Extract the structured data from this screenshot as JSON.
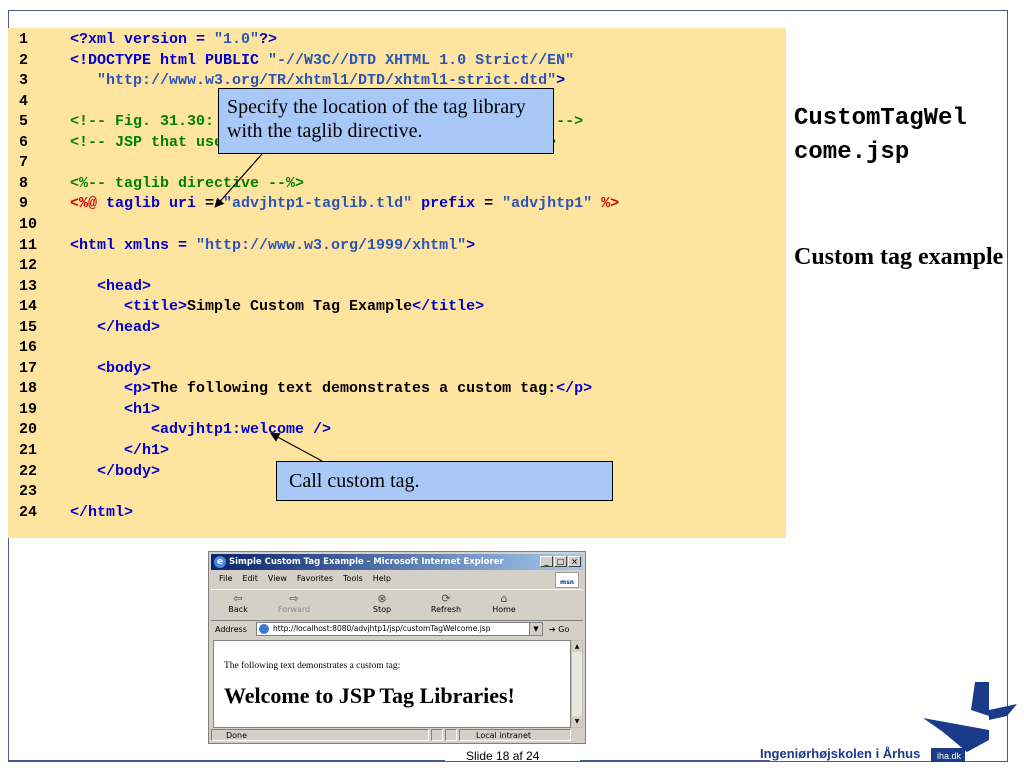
{
  "code_lines": [
    {
      "num": "1",
      "parts": [
        {
          "t": "<?xml version = ",
          "c": "tag"
        },
        {
          "t": "\"1.0\"",
          "c": "str"
        },
        {
          "t": "?>",
          "c": "tag"
        }
      ]
    },
    {
      "num": "2",
      "parts": [
        {
          "t": "<!DOCTYPE html PUBLIC ",
          "c": "tag"
        },
        {
          "t": "\"-//W3C//DTD XHTML 1.0 Strict//EN\"",
          "c": "str"
        }
      ]
    },
    {
      "num": "3",
      "parts": [
        {
          "t": "   \"http://www.w3.org/TR/xhtml1/DTD/xhtml1-strict.dtd\"",
          "c": "str"
        },
        {
          "t": ">",
          "c": "tag"
        }
      ]
    },
    {
      "num": "4",
      "parts": []
    },
    {
      "num": "5",
      "parts": [
        {
          "t": "<!-- Fig. 31.30: CustomTagWelcome.jsp                 -->",
          "c": "com"
        }
      ]
    },
    {
      "num": "6",
      "parts": [
        {
          "t": "<!-- JSP that uses a custom tag to output content. -->",
          "c": "com"
        }
      ]
    },
    {
      "num": "7",
      "parts": []
    },
    {
      "num": "8",
      "parts": [
        {
          "t": "<%-- taglib directive --%>",
          "c": "com"
        }
      ]
    },
    {
      "num": "9",
      "parts": [
        {
          "t": "<%@ ",
          "c": "dir"
        },
        {
          "t": "taglib uri",
          "c": "tag"
        },
        {
          "t": " = ",
          "c": "txt"
        },
        {
          "t": "\"advjhtp1-taglib.tld\"",
          "c": "str"
        },
        {
          "t": " prefix",
          "c": "tag"
        },
        {
          "t": " = ",
          "c": "txt"
        },
        {
          "t": "\"advjhtp1\"",
          "c": "str"
        },
        {
          "t": " %>",
          "c": "dir"
        }
      ]
    },
    {
      "num": "10",
      "parts": []
    },
    {
      "num": "11",
      "parts": [
        {
          "t": "<html xmlns = ",
          "c": "tag"
        },
        {
          "t": "\"http://www.w3.org/1999/xhtml\"",
          "c": "str"
        },
        {
          "t": ">",
          "c": "tag"
        }
      ]
    },
    {
      "num": "12",
      "parts": []
    },
    {
      "num": "13",
      "parts": [
        {
          "t": "   <head>",
          "c": "tag"
        }
      ]
    },
    {
      "num": "14",
      "parts": [
        {
          "t": "      <title>",
          "c": "tag"
        },
        {
          "t": "Simple Custom Tag Example",
          "c": "txt"
        },
        {
          "t": "</title>",
          "c": "tag"
        }
      ]
    },
    {
      "num": "15",
      "parts": [
        {
          "t": "   </head>",
          "c": "tag"
        }
      ]
    },
    {
      "num": "16",
      "parts": []
    },
    {
      "num": "17",
      "parts": [
        {
          "t": "   <body>",
          "c": "tag"
        }
      ]
    },
    {
      "num": "18",
      "parts": [
        {
          "t": "      <p>",
          "c": "tag"
        },
        {
          "t": "The following text demonstrates a custom tag:",
          "c": "txt"
        },
        {
          "t": "</p>",
          "c": "tag"
        }
      ]
    },
    {
      "num": "19",
      "parts": [
        {
          "t": "      <h1>",
          "c": "tag"
        }
      ]
    },
    {
      "num": "20",
      "parts": [
        {
          "t": "         <advjhtp1:welcome />",
          "c": "tag"
        }
      ]
    },
    {
      "num": "21",
      "parts": [
        {
          "t": "      </h1>",
          "c": "tag"
        }
      ]
    },
    {
      "num": "22",
      "parts": [
        {
          "t": "   </body>",
          "c": "tag"
        }
      ]
    },
    {
      "num": "23",
      "parts": []
    },
    {
      "num": "24",
      "parts": [
        {
          "t": "</html>",
          "c": "tag"
        }
      ]
    }
  ],
  "callouts": {
    "taglib": "Specify the location of the tag library with the taglib directive.",
    "custom_tag": "Call custom tag."
  },
  "side": {
    "title": "CustomTagWelcome.jsp",
    "subtitle": "Custom tag example"
  },
  "browser": {
    "title": "Simple Custom Tag Example - Microsoft Internet Explorer",
    "menu": [
      "File",
      "Edit",
      "View",
      "Favorites",
      "Tools",
      "Help"
    ],
    "toolbar": {
      "back": "Back",
      "forward": "Forward",
      "stop": "Stop",
      "refresh": "Refresh",
      "home": "Home"
    },
    "address_label": "Address",
    "address_value": "http://localhost:8080/advjhtp1/jsp/customTagWelcome.jsp",
    "go_label": "Go",
    "content_p": "The following text demonstrates a custom tag:",
    "content_h1": "Welcome to JSP Tag Libraries!",
    "status_left": "Done",
    "status_zone": "Local intranet",
    "logo_text": "msn"
  },
  "footer": {
    "slide": "Slide 18 af  24",
    "school": "Ingeniørhøjskolen i Århus",
    "logo_text": "iha.dk"
  },
  "colors": {
    "code_bg": "#ffe4a0",
    "tag": "#0000cc",
    "string": "#2a55b8",
    "comment": "#008000",
    "directive": "#cc0000",
    "callout_bg": "#a8c8f8",
    "frame": "#4a5a8a"
  }
}
